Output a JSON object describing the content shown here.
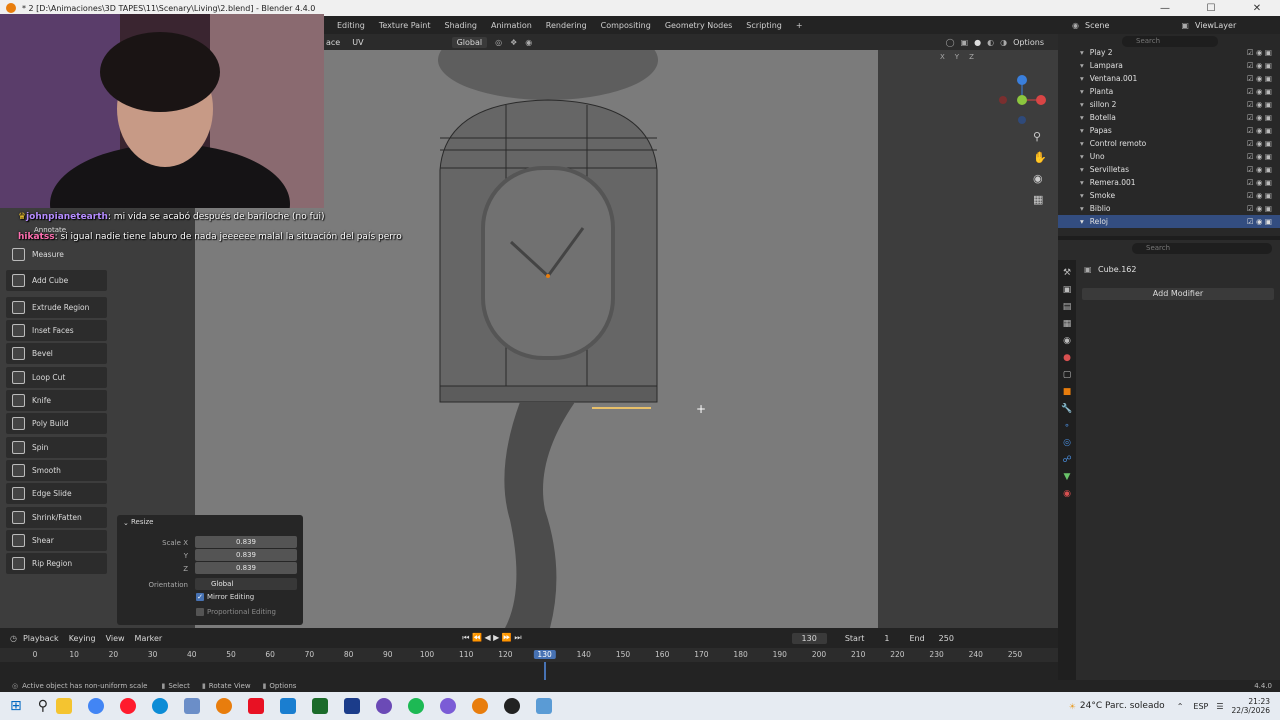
{
  "window": {
    "title": "* 2 [D:\\Animaciones\\3D TAPES\\11\\Scenary\\Living\\2.blend] - Blender 4.4.0"
  },
  "menu": [
    "Editing",
    "Texture Paint",
    "Shading",
    "Animation",
    "Rendering",
    "Compositing",
    "Geometry Nodes",
    "Scripting"
  ],
  "scene": {
    "scene_label": "Scene",
    "view_layer_label": "ViewLayer"
  },
  "viewport_header": {
    "mode_tail": "ace",
    "uv": "UV",
    "orientation": "Global",
    "options": "Options",
    "axes": [
      "X",
      "Y",
      "Z"
    ]
  },
  "chat": [
    {
      "user": "johnpianetearth",
      "message": ": mi vida se acabó después de bariloche (no fui)"
    },
    {
      "user": "hikatss",
      "message": ": si igual nadie tiene laburo de nada jeeeeee malal la situación del país perro"
    }
  ],
  "toolbar": {
    "annotate": "Annotate",
    "items": [
      "Measure",
      "Add Cube",
      "Extrude Region",
      "Inset Faces",
      "Bevel",
      "Loop Cut",
      "Knife",
      "Poly Build",
      "Spin",
      "Smooth",
      "Edge Slide",
      "Shrink/Fatten",
      "Shear",
      "Rip Region"
    ]
  },
  "resize_panel": {
    "title": "Resize",
    "scale_x_label": "Scale X",
    "y_label": "Y",
    "z_label": "Z",
    "scale_x": "0.839",
    "scale_y": "0.839",
    "scale_z": "0.839",
    "orientation_label": "Orientation",
    "orientation": "Global",
    "mirror_editing": "Mirror Editing",
    "mirror_checked": true,
    "proportional_editing": "Proportional Editing",
    "proportional_checked": false
  },
  "outliner": {
    "search_placeholder": "Search",
    "items": [
      "Play 2",
      "Lampara",
      "Ventana.001",
      "Planta",
      "sillon 2",
      "Botella",
      "Papas",
      "Control remoto",
      "Uno",
      "Servilletas",
      "Remera.001",
      "Smoke",
      "Biblio",
      "Reloj"
    ],
    "active_item": "Reloj"
  },
  "properties": {
    "object_name": "Cube.162",
    "add_modifier": "Add Modifier",
    "search_placeholder": "Search"
  },
  "timeline": {
    "menu": [
      "Playback",
      "Keying",
      "View",
      "Marker"
    ],
    "current_frame": "130",
    "start_label": "Start",
    "start": "1",
    "end_label": "End",
    "end": "250",
    "ticks": [
      "0",
      "10",
      "20",
      "30",
      "40",
      "50",
      "60",
      "70",
      "80",
      "90",
      "100",
      "110",
      "120",
      "130",
      "140",
      "150",
      "160",
      "170",
      "180",
      "190",
      "200",
      "210",
      "220",
      "230",
      "240",
      "250"
    ]
  },
  "status": {
    "message": "Active object has non-uniform scale",
    "select": "Select",
    "rotate": "Rotate View",
    "options": "Options",
    "version": "4.4.0"
  },
  "taskbar": {
    "weather": "24°C  Parc. soleado",
    "lang": "ESP",
    "time": "21:23",
    "date": "22/3/2026"
  },
  "colors": {
    "accent": "#4772b3",
    "active_frame": "#4772b3",
    "outliner_active": "#334d80",
    "selection": "#e87d0d",
    "chat_user1": "#b58cff",
    "chat_user2": "#ff6fb0"
  }
}
